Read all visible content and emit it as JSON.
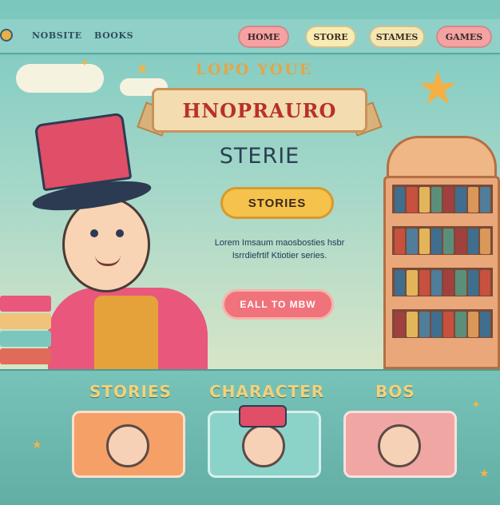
{
  "nav": {
    "left_links": [
      "NOBSITE",
      "BOOKS"
    ],
    "buttons": [
      {
        "label": "HOME",
        "color": "#f6a1a3"
      },
      {
        "label": "STORE",
        "color": "#f7ecb1"
      },
      {
        "label": "STAMES",
        "color": "#f3e6b0"
      },
      {
        "label": "GAMES",
        "color": "#f4a2a2"
      }
    ]
  },
  "hero": {
    "banner_small": "LOPO YOUE",
    "banner_main": "HNOPRAURO",
    "title": "STERIE",
    "primary_button": "STORIES",
    "description_lines": [
      "Lorem Imsaum maosbosties hsbr",
      "Isrrdiefrtif Ktiotier series."
    ],
    "cta_button": "EALL TO MBW"
  },
  "sections": [
    {
      "title": "STORIES",
      "card_color": "#f4a067"
    },
    {
      "title": "CHARACTER",
      "card_color": "#8bd3c9"
    },
    {
      "title": "BOS",
      "card_color": "#f0a7a4"
    }
  ],
  "colors": {
    "teal_bg": "#7cc7bd",
    "accent_yellow": "#f5c24b",
    "accent_pink": "#f0727a"
  }
}
